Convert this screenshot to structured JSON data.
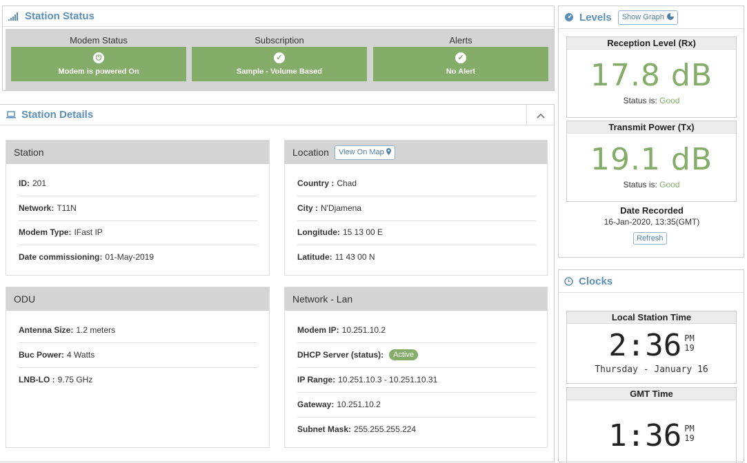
{
  "status": {
    "title": "Station Status",
    "modem": {
      "label": "Modem Status",
      "value": "Modem is powered On"
    },
    "subscription": {
      "label": "Subscription",
      "value": "Sample - Volume Based"
    },
    "alerts": {
      "label": "Alerts",
      "value": "No Alert"
    }
  },
  "details": {
    "title": "Station Details",
    "station": {
      "title": "Station",
      "rows": [
        {
          "k": "ID:",
          "v": "201"
        },
        {
          "k": "Network:",
          "v": "T11N"
        },
        {
          "k": "Modem Type:",
          "v": "IFast IP"
        },
        {
          "k": "Date commissioning:",
          "v": "01-May-2019"
        }
      ]
    },
    "location": {
      "title": "Location",
      "map_button": "View On Map",
      "rows": [
        {
          "k": "Country :",
          "v": "Chad"
        },
        {
          "k": "City :",
          "v": "N'Djamena"
        },
        {
          "k": "Longitude:",
          "v": "15 13 00 E"
        },
        {
          "k": "Latitude:",
          "v": "11 43 00 N"
        }
      ]
    },
    "odu": {
      "title": "ODU",
      "rows": [
        {
          "k": "Antenna Size:",
          "v": "1.2 meters"
        },
        {
          "k": "Buc Power:",
          "v": "4 Watts"
        },
        {
          "k": "LNB-LO :",
          "v": "9.75 GHz"
        }
      ]
    },
    "lan": {
      "title": "Network - Lan",
      "rows": [
        {
          "k": "Modem IP:",
          "v": "10.251.10.2"
        },
        {
          "k": "DHCP Server (status):",
          "v": "Active"
        },
        {
          "k": "IP Range:",
          "v": "10.251.10.3 - 10.251.10.31"
        },
        {
          "k": "Gateway:",
          "v": "10.251.10.2"
        },
        {
          "k": "Subnet Mask:",
          "v": "255.255.255.224"
        }
      ]
    }
  },
  "levels": {
    "title": "Levels",
    "graph_button": "Show Graph",
    "rx": {
      "label": "Reception Level (Rx)",
      "value": "17.8 dB",
      "status_label": "Status is:",
      "status": "Good"
    },
    "tx": {
      "label": "Transmit Power (Tx)",
      "value": "19.1 dB",
      "status_label": "Status is:",
      "status": "Good"
    },
    "date_label": "Date Recorded",
    "date_value": "16-Jan-2020, 13:35(GMT)",
    "refresh": "Refresh"
  },
  "clocks": {
    "title": "Clocks",
    "local": {
      "label": "Local Station Time",
      "time": "2:36",
      "ampm": "PM",
      "seconds": "19",
      "date": "Thursday - January 16"
    },
    "gmt": {
      "label": "GMT Time",
      "time": "1:36",
      "ampm": "PM",
      "seconds": "19"
    }
  },
  "colors": {
    "accent": "#5b8fb9",
    "good": "#84ad69",
    "header_gray": "#d4d4d4"
  }
}
